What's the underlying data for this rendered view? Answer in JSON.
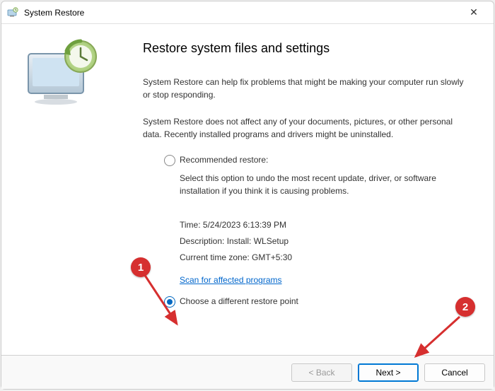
{
  "window": {
    "title": "System Restore",
    "close_symbol": "✕"
  },
  "main": {
    "heading": "Restore system files and settings",
    "para1": "System Restore can help fix problems that might be making your computer run slowly or stop responding.",
    "para2": "System Restore does not affect any of your documents, pictures, or other personal data. Recently installed programs and drivers might be uninstalled."
  },
  "options": {
    "recommended": {
      "label": "Recommended restore:",
      "description": "Select this option to undo the most recent update, driver, or software installation if you think it is causing problems.",
      "time": "Time: 5/24/2023 6:13:39 PM",
      "desc_line": "Description: Install: WLSetup",
      "tz": "Current time zone: GMT+5:30",
      "scan_link": "Scan for affected programs"
    },
    "different": {
      "label": "Choose a different restore point"
    }
  },
  "footer": {
    "back": "< Back",
    "next": "Next >",
    "cancel": "Cancel"
  },
  "callouts": {
    "one": "1",
    "two": "2"
  }
}
